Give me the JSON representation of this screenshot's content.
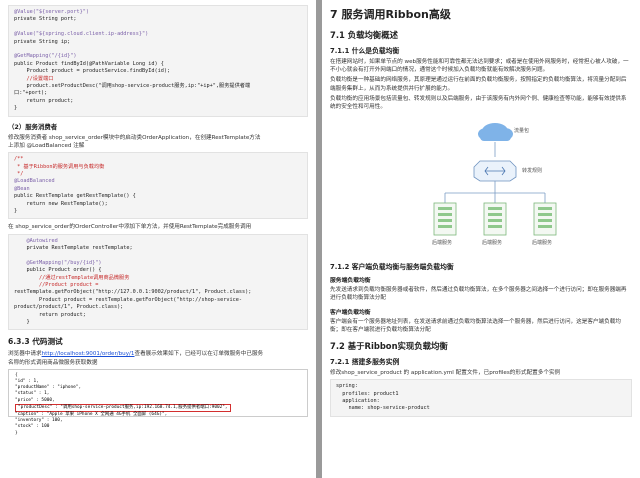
{
  "left": {
    "code1": [
      "@Value(\"${server.port}\")",
      "private String port;",
      "",
      "@Value(\"${spring.cloud.client.ip-address}\")",
      "private String ip;",
      "",
      "@GetMapping(\"/{id}\")",
      "public Product findById(@PathVariable Long id) {",
      "    Product product = productService.findById(id);",
      "    //设置端口",
      "    product.setProductDesc(\"调用shop-service-product服务,ip:\"+ip+\",服务提供者端",
      "口:\"+port);",
      "    return product;",
      "}"
    ],
    "consumer_heading": "（2）服务消费者",
    "consumer_text_a": "修改服务消费者 shop_service_order模块中的启动类OrderApplication，在创建RestTemplate方法",
    "consumer_text_b": "上添加 @LoadBalanced 注解",
    "code2": [
      "/**",
      " * 基于Ribbon的服务调用与负载均衡",
      " */",
      "@LoadBalanced",
      "@Bean",
      "public RestTemplate getRestTemplate() {",
      "    return new RestTemplate();",
      "}"
    ],
    "order_text": "在 shop_service_order的OrderController中添加下单方法，并使用RestTemplate完成服务调用",
    "code3": [
      "    @Autowired",
      "    private RestTemplate restTemplate;",
      "",
      "    @GetMapping(\"/buy/{id}\")",
      "    public Product order() {",
      "        //通过restTemplate调用商品微服务",
      "        //Product product =",
      "restTemplate.getForObject(\"http://127.0.0.1:9002/product/1\", Product.class);",
      "        Product product = restTemplate.getForObject(\"http://shop-service-",
      "product/product/1\", Product.class);",
      "        return product;",
      "    }"
    ],
    "test_heading": "6.3.3 代码测试",
    "test_text_a": "浏览器中请求",
    "test_link": "http://localhost:9001/order/buy/1",
    "test_text_b": "查看展示效果如下，已经可以在订单微服务中已服务",
    "test_text_c": "名称的形式调用商品微服务获取数据",
    "screenshot_lines": [
      "{",
      "  \"id\" : 1,",
      "  \"productName\" : \"iphone\",",
      "  \"status\" : 1,",
      "  \"price\" : 5000,",
      "  \"productDesc\" : \"调用shop-service-product服务,ip:192.168.74.1,服务提供者端口:9002\",",
      "  \"caption\" : \"Apple 苹果 iPhone X 全网通 4G手机 全面屏 (64G)\",",
      "  \"inventory\" : 100,",
      "  \"stock\" : 100",
      "}"
    ]
  },
  "right": {
    "h1": "7 服务调用Ribbon高级",
    "h2_1": "7.1 负载均衡概述",
    "h3_1": "7.1.1 什么是负载均衡",
    "p1": "在搭建网站时，如果单节点的 web服务性能和可靠性都无法达到要求；或者是在使用外网服务时，经常担心被人攻破，一不小心就会有打开外网端口的情况，通常这个时候加入负载均衡就能有效解决服务问题。",
    "p2": "负载均衡是一种基础的网络服务，其原理是通过运行在前面的负载均衡服务，按照指定的负载均衡算法，将流量分配到后端服务集群上，从而为系统提供并行扩展的能力。",
    "p3": "负载均衡的应用场景包括流量包、转发规则以及后端服务，由于该服务有内外网个例、健康检查等功能，能够有效提供系统的安全性和可用性。",
    "diagram": {
      "label_traffic": "流量包",
      "label_rule": "转发规则",
      "label_backend": "后端服务"
    },
    "h3_2": "7.1.2 客户端负载均衡与服务端负载均衡",
    "h4_server": "服务端负载均衡",
    "p4": "先发送请求到负载均衡服务器或者软件，然后通过负载均衡算法，在多个服务器之间选择一个进行访问；即在服务器端再进行负载均衡算法分配",
    "h4_client": "客户端负载均衡",
    "p5": "客户端会有一个服务器地址列表，在发送请求前通过负载均衡算法选择一个服务器，然后进行访问，这是客户端负载均衡；即在客户端就进行负载均衡算法分配",
    "h2_2": "7.2 基于Ribbon实现负载均衡",
    "h3_3": "7.2.1 搭建多服务实例",
    "p6": "修改shop_service_product 的 application.yml 配置文件，已profiles的形式配置多个实例",
    "code_yaml": [
      "spring:",
      "  profiles: product1",
      "  application:",
      "    name: shop-service-product"
    ]
  }
}
